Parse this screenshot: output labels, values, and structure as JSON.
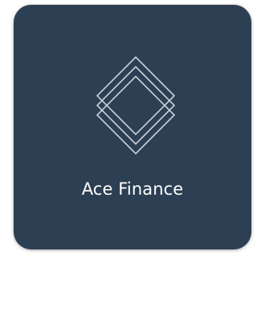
{
  "app": {
    "name": "Ace Finance",
    "icon": "diamond-logo-icon"
  },
  "colors": {
    "tile_background": "#2d3f53",
    "logo_stroke": "#c9d1d9",
    "text": "#ffffff"
  }
}
